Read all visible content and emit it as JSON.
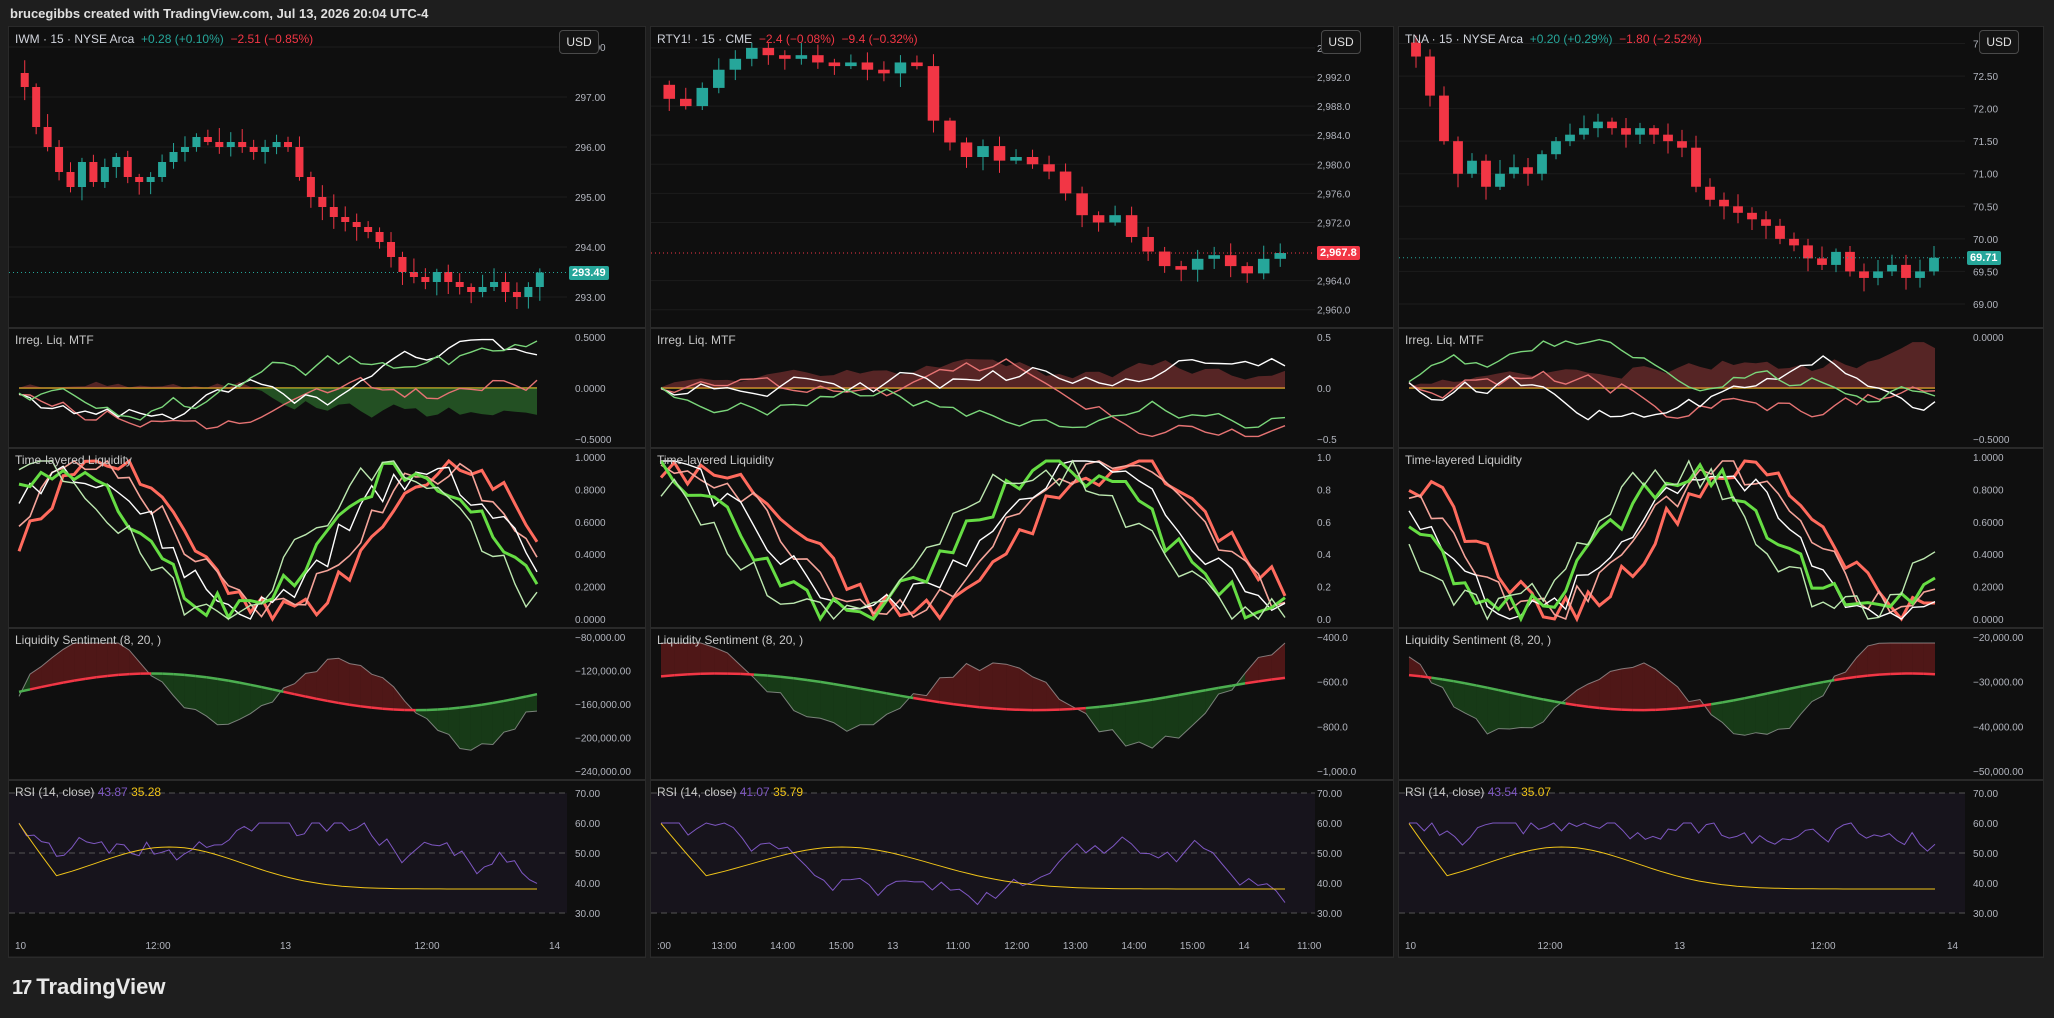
{
  "header": {
    "credit": "brucegibbs created with TradingView.com, Jul 13, 2026 20:04 UTC-4"
  },
  "footer": {
    "brand": "TradingView"
  },
  "colors": {
    "up": "#26a69a",
    "down": "#f23645",
    "rsi": "#7e57c2",
    "rsi_ma": "#f0c419"
  },
  "panels": [
    {
      "title": "IWM · 15 · NYSE Arca",
      "change1": "+0.28 (+0.10%)",
      "change2": "−2.51 (−0.85%)",
      "currency": "USD",
      "last_price": "293.49",
      "price_axis": [
        "298.00",
        "297.00",
        "296.00",
        "295.00",
        "294.00",
        "293.00"
      ],
      "irreg_axis": [
        "0.5000",
        "0.0000",
        "−0.5000"
      ],
      "time_axis_labels": [
        "1.0000",
        "0.8000",
        "0.6000",
        "0.4000",
        "0.2000",
        "0.0000"
      ],
      "sent_axis": [
        "−80,000.00",
        "−120,000.00",
        "−160,000.00",
        "−200,000.00",
        "−240,000.00"
      ],
      "rsi_axis": [
        "70.00",
        "60.00",
        "50.00",
        "40.00",
        "30.00"
      ],
      "x_axis": [
        "10",
        "12:00",
        "13",
        "12:00",
        "14"
      ],
      "irreg_title": "Irreg. Liq. MTF",
      "layered_title": "Time-layered Liquidity",
      "sent_title": "Liquidity Sentiment (8, 20, )",
      "rsi_title": "RSI (14, close)",
      "rsi_ma_value": "43.87",
      "rsi_value": "35.28"
    },
    {
      "title": "RTY1! · 15 · CME",
      "change1": "−2.4 (−0.08%)",
      "change2": "−9.4 (−0.32%)",
      "currency": "USD",
      "last_price": "2,967.8",
      "price_axis": [
        "2,996.0",
        "2,992.0",
        "2,988.0",
        "2,984.0",
        "2,980.0",
        "2,976.0",
        "2,972.0",
        "2,964.0",
        "2,960.0"
      ],
      "irreg_axis": [
        "0.5",
        "0.0",
        "−0.5"
      ],
      "time_axis_labels": [
        "1.0",
        "0.8",
        "0.6",
        "0.4",
        "0.2",
        "0.0"
      ],
      "sent_axis": [
        "−400.0",
        "−600.0",
        "−800.0",
        "−1,000.0"
      ],
      "rsi_axis": [
        "70.00",
        "60.00",
        "50.00",
        "40.00",
        "30.00"
      ],
      "x_axis": [
        ":00",
        "13:00",
        "14:00",
        "15:00",
        "13",
        "11:00",
        "12:00",
        "13:00",
        "14:00",
        "15:00",
        "14",
        "11:00"
      ],
      "irreg_title": "Irreg. Liq. MTF",
      "layered_title": "Time-layered Liquidity",
      "sent_title": "Liquidity Sentiment (8, 20, )",
      "rsi_title": "RSI (14, close)",
      "rsi_ma_value": "41.07",
      "rsi_value": "35.79"
    },
    {
      "title": "TNA · 15 · NYSE Arca",
      "change1": "+0.20 (+0.29%)",
      "change2": "−1.80 (−2.52%)",
      "currency": "USD",
      "last_price": "69.71",
      "price_axis": [
        "73.00",
        "72.50",
        "72.00",
        "71.50",
        "71.00",
        "70.50",
        "70.00",
        "69.50",
        "69.00"
      ],
      "irreg_axis": [
        "0.0000",
        "−0.5000"
      ],
      "time_axis_labels": [
        "1.0000",
        "0.8000",
        "0.6000",
        "0.4000",
        "0.2000",
        "0.0000"
      ],
      "sent_axis": [
        "−20,000.00",
        "−30,000.00",
        "−40,000.00",
        "−50,000.00"
      ],
      "rsi_axis": [
        "70.00",
        "60.00",
        "50.00",
        "40.00",
        "30.00"
      ],
      "x_axis": [
        "10",
        "12:00",
        "13",
        "12:00",
        "14"
      ],
      "irreg_title": "Irreg. Liq. MTF",
      "layered_title": "Time-layered Liquidity",
      "sent_title": "Liquidity Sentiment (8, 20, )",
      "rsi_title": "RSI (14, close)",
      "rsi_ma_value": "43.54",
      "rsi_value": "35.07"
    }
  ],
  "chart_data": [
    {
      "type": "candlestick",
      "symbol": "IWM",
      "ylim": [
        292.6,
        298.2
      ],
      "close": [
        297.2,
        296.4,
        296.0,
        295.5,
        295.2,
        295.7,
        295.3,
        295.6,
        295.8,
        295.4,
        295.3,
        295.4,
        295.7,
        295.9,
        296.0,
        296.2,
        296.1,
        296.0,
        296.1,
        296.0,
        295.9,
        296.0,
        296.1,
        296.0,
        295.4,
        295.0,
        294.8,
        294.6,
        294.5,
        294.4,
        294.3,
        294.1,
        293.8,
        293.5,
        293.4,
        293.3,
        293.5,
        293.3,
        293.2,
        293.1,
        293.2,
        293.3,
        293.1,
        293.0,
        293.2,
        293.49
      ]
    },
    {
      "type": "candlestick",
      "symbol": "RTY1!",
      "ylim": [
        2959.0,
        2997.5
      ],
      "close": [
        2989.0,
        2988.0,
        2990.5,
        2993.0,
        2994.5,
        2996.0,
        2995.0,
        2994.5,
        2995.0,
        2994.0,
        2993.5,
        2994.0,
        2993.0,
        2992.5,
        2994.0,
        2993.5,
        2986.0,
        2983.0,
        2981.0,
        2982.5,
        2980.5,
        2981.0,
        2980.0,
        2979.0,
        2976.0,
        2973.0,
        2972.0,
        2973.0,
        2970.0,
        2968.0,
        2966.0,
        2965.5,
        2967.0,
        2967.5,
        2966.0,
        2965.0,
        2967.0,
        2967.8
      ]
    },
    {
      "type": "candlestick",
      "symbol": "TNA",
      "ylim": [
        68.8,
        73.1
      ],
      "close": [
        72.8,
        72.2,
        71.5,
        71.0,
        71.2,
        70.8,
        71.0,
        71.1,
        71.0,
        71.3,
        71.5,
        71.6,
        71.7,
        71.8,
        71.7,
        71.6,
        71.7,
        71.6,
        71.5,
        71.4,
        70.8,
        70.6,
        70.5,
        70.4,
        70.3,
        70.2,
        70.0,
        69.9,
        69.7,
        69.6,
        69.8,
        69.5,
        69.4,
        69.5,
        69.6,
        69.4,
        69.5,
        69.71
      ]
    }
  ]
}
